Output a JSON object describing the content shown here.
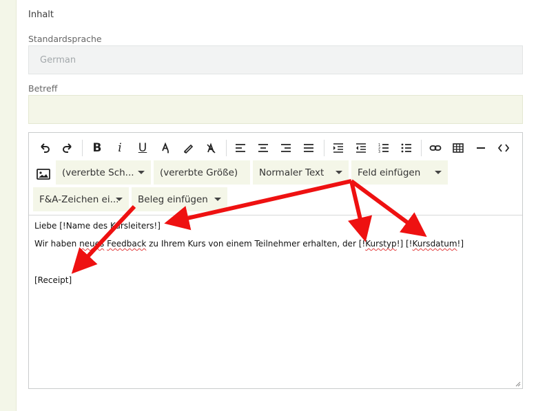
{
  "section_title": "Inhalt",
  "language": {
    "label": "Standardsprache",
    "value": "German"
  },
  "subject": {
    "label": "Betreff",
    "value": ""
  },
  "toolbar": {
    "icons": [
      "undo-icon",
      "redo-icon",
      "bold-icon",
      "italic-icon",
      "underline-icon",
      "text-color-icon",
      "highlight-icon",
      "clear-format-icon",
      "align-left-icon",
      "align-center-icon",
      "align-right-icon",
      "align-justify-icon",
      "indent-icon",
      "outdent-icon",
      "ordered-list-icon",
      "bullet-list-icon",
      "link-icon",
      "table-icon",
      "horizontal-rule-icon",
      "code-view-icon",
      "image-icon"
    ],
    "bold": "B",
    "italic": "i",
    "underline": "U",
    "font_family": "(vererbte Sch...",
    "font_size": "(vererbte Größe)",
    "paragraph": "Normaler Text",
    "insert_field": "Feld einfügen",
    "insert_faq": "F&A-Zeichen ei...",
    "insert_receipt": "Beleg einfügen"
  },
  "content": {
    "line1_a": "Liebe ",
    "line1_b": "[!Name des Kursleiters!]",
    "line2_a": "Wir haben ",
    "line2_b": "neues",
    "line2_c": " ",
    "line2_d": "Feedback",
    "line2_e": " zu Ihrem Kurs von einem Teilnehmer erhalten, der [!",
    "line2_f": "Kurstyp",
    "line2_g": "!] [!",
    "line2_h": "Kursdatum",
    "line2_i": "!]",
    "line3": "[Receipt]"
  },
  "colors": {
    "accent_bg": "#f4f6e8",
    "arrow": "#ee1111"
  }
}
